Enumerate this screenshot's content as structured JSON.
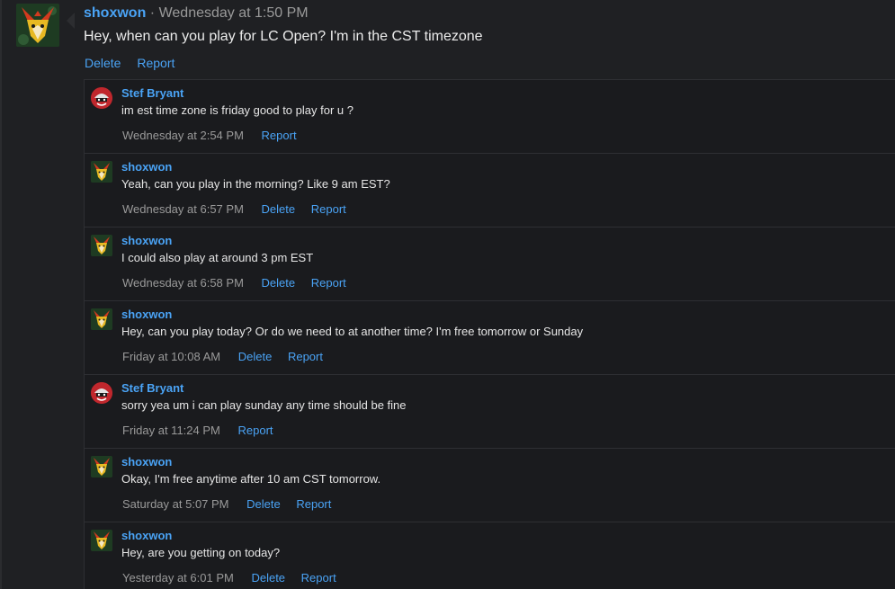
{
  "post": {
    "author": "shoxwon",
    "separator": "·",
    "time": "Wednesday at 1:50 PM",
    "body": "Hey, when can you play for LC Open? I'm in the CST timezone",
    "delete_label": "Delete",
    "report_label": "Report"
  },
  "replies": [
    {
      "author": "Stef Bryant",
      "text": "im est time zone is friday good to play for u ?",
      "time": "Wednesday at 2:54 PM",
      "report": "Report"
    },
    {
      "author": "shoxwon",
      "text": "Yeah, can you play in the morning? Like 9 am EST?",
      "time": "Wednesday at 6:57 PM",
      "delete": "Delete",
      "report": "Report"
    },
    {
      "author": "shoxwon",
      "text": "I could also play at around 3 pm EST",
      "time": "Wednesday at 6:58 PM",
      "delete": "Delete",
      "report": "Report"
    },
    {
      "author": "shoxwon",
      "text": "Hey, can you play today? Or do we need to at another time? I'm free tomorrow or Sunday",
      "time": "Friday at 10:08 AM",
      "delete": "Delete",
      "report": "Report"
    },
    {
      "author": "Stef Bryant",
      "text": "sorry yea um i can play sunday any time should be fine",
      "time": "Friday at 11:24 PM",
      "report": "Report"
    },
    {
      "author": "shoxwon",
      "text": "Okay, I'm free anytime after 10 am CST tomorrow.",
      "time": "Saturday at 5:07 PM",
      "delete": "Delete",
      "report": "Report"
    },
    {
      "author": "shoxwon",
      "text": "Hey, are you getting on today?",
      "time": "Yesterday at 6:01 PM",
      "delete": "Delete",
      "report": "Report"
    }
  ],
  "colors": {
    "background": "#1f2023",
    "link": "#4aa3f5",
    "muted": "#9a9a9a",
    "text": "#e6e6e6"
  },
  "icons": {
    "shoxwon_avatar": "fox-mascot-avatar",
    "stef_avatar": "red-helmet-mascot-avatar"
  }
}
